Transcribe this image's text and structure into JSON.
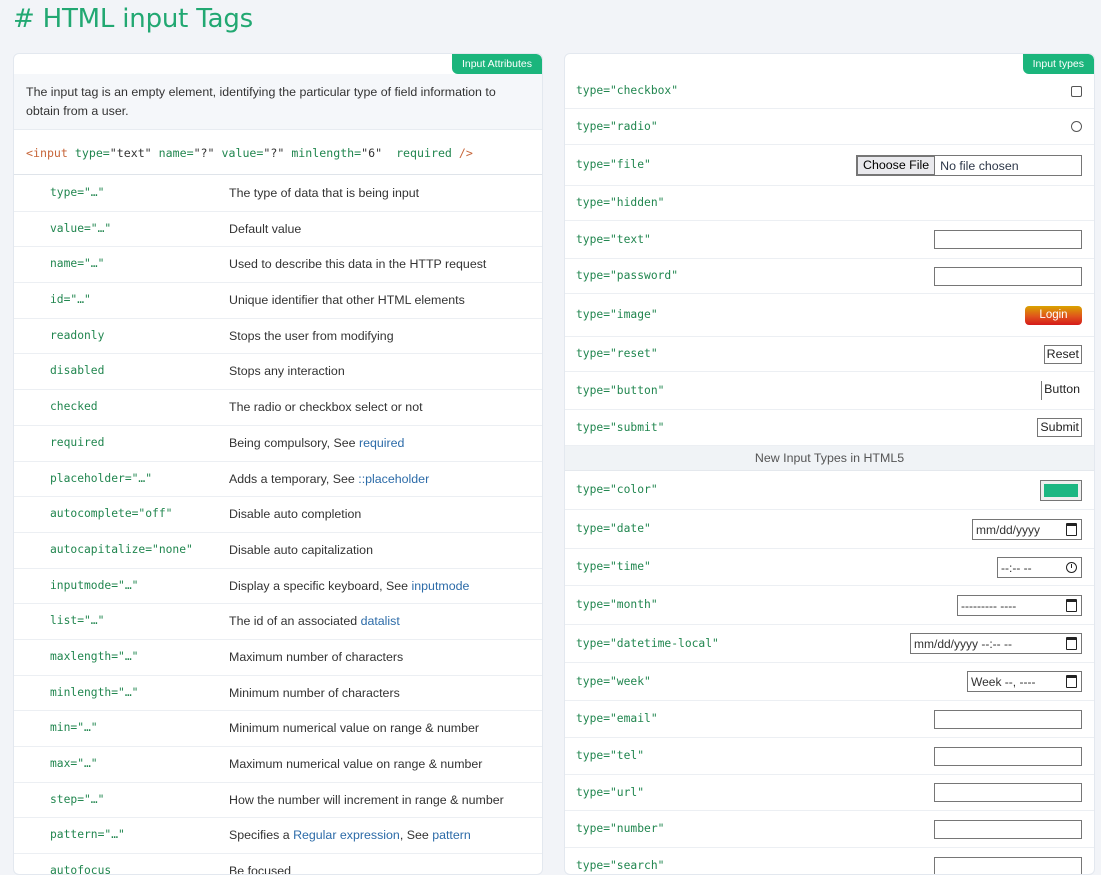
{
  "page": {
    "title": "# HTML input Tags"
  },
  "left": {
    "tag": "Input Attributes",
    "description": "The input tag is an empty element, identifying the particular type of field information to obtain from a user.",
    "example": {
      "open": "<input",
      "type_attr": "type=",
      "type_val": "\"text\"",
      "name_attr": "name=",
      "name_val": "\"?\"",
      "value_attr": "value=",
      "value_val": "\"?\"",
      "minlength_attr": "minlength=",
      "minlength_val": "\"6\"",
      "required": "required",
      "close": "/>"
    },
    "attributes": [
      {
        "name": "type=\"…\"",
        "desc": "The type of data that is being input",
        "link": ""
      },
      {
        "name": "value=\"…\"",
        "desc": "Default value",
        "link": ""
      },
      {
        "name": "name=\"…\"",
        "desc": "Used to describe this data in the HTTP request",
        "link": ""
      },
      {
        "name": "id=\"…\"",
        "desc": "Unique identifier that other HTML elements",
        "link": ""
      },
      {
        "name": "readonly",
        "desc": "Stops the user from modifying",
        "link": ""
      },
      {
        "name": "disabled",
        "desc": "Stops any interaction",
        "link": ""
      },
      {
        "name": "checked",
        "desc": "The radio or checkbox select or not",
        "link": ""
      },
      {
        "name": "required",
        "desc": "Being compulsory, See ",
        "link": "required"
      },
      {
        "name": "placeholder=\"…\"",
        "desc": "Adds a temporary, See ",
        "link": "::placeholder"
      },
      {
        "name": "autocomplete=\"off\"",
        "desc": "Disable auto completion",
        "link": ""
      },
      {
        "name": "autocapitalize=\"none\"",
        "desc": "Disable auto capitalization",
        "link": ""
      },
      {
        "name": "inputmode=\"…\"",
        "desc": "Display a specific keyboard, See ",
        "link": "inputmode"
      },
      {
        "name": "list=\"…\"",
        "desc": "The id of an associated ",
        "link": "datalist"
      },
      {
        "name": "maxlength=\"…\"",
        "desc": "Maximum number of characters",
        "link": ""
      },
      {
        "name": "minlength=\"…\"",
        "desc": "Minimum number of characters",
        "link": ""
      },
      {
        "name": "min=\"…\"",
        "desc": "Minimum numerical value on range & number",
        "link": ""
      },
      {
        "name": "max=\"…\"",
        "desc": "Maximum numerical value on range & number",
        "link": ""
      },
      {
        "name": "step=\"…\"",
        "desc": "How the number will increment in range & number",
        "link": ""
      },
      {
        "name": "pattern=\"…\"",
        "desc": "Specifies a ",
        "link": "Regular expression",
        "desc2": ", See ",
        "link2": "pattern"
      },
      {
        "name": "autofocus",
        "desc": "Be focused",
        "link": ""
      }
    ]
  },
  "right": {
    "tag": "Input types",
    "types_basic": [
      {
        "name": "type=\"checkbox\"",
        "control": "checkbox"
      },
      {
        "name": "type=\"radio\"",
        "control": "radio"
      },
      {
        "name": "type=\"file\"",
        "control": "file",
        "button": "Choose File",
        "status": "No file chosen"
      },
      {
        "name": "type=\"hidden\"",
        "control": "none"
      },
      {
        "name": "type=\"text\"",
        "control": "textbox"
      },
      {
        "name": "type=\"password\"",
        "control": "textbox"
      },
      {
        "name": "type=\"image\"",
        "control": "image",
        "label": "Login"
      },
      {
        "name": "type=\"reset\"",
        "control": "button",
        "label": "Reset"
      },
      {
        "name": "type=\"button\"",
        "control": "button-left",
        "label": "Button"
      },
      {
        "name": "type=\"submit\"",
        "control": "button",
        "label": "Submit"
      }
    ],
    "section_html5": "New Input Types in HTML5",
    "types_html5": [
      {
        "name": "type=\"color\"",
        "control": "color",
        "color": "#1cb782"
      },
      {
        "name": "type=\"date\"",
        "control": "date",
        "value": "mm/dd/yyyy",
        "icon": "calendar-icon"
      },
      {
        "name": "type=\"time\"",
        "control": "time",
        "value": "--:-- --",
        "icon": "clock-icon"
      },
      {
        "name": "type=\"month\"",
        "control": "month",
        "value": "--------- ----",
        "icon": "calendar-icon"
      },
      {
        "name": "type=\"datetime-local\"",
        "control": "datetime",
        "value": "mm/dd/yyyy --:-- --",
        "icon": "calendar-icon"
      },
      {
        "name": "type=\"week\"",
        "control": "week",
        "value": "Week --, ----",
        "icon": "calendar-icon"
      },
      {
        "name": "type=\"email\"",
        "control": "textbox"
      },
      {
        "name": "type=\"tel\"",
        "control": "textbox"
      },
      {
        "name": "type=\"url\"",
        "control": "textbox"
      },
      {
        "name": "type=\"number\"",
        "control": "textbox"
      },
      {
        "name": "type=\"search\"",
        "control": "textbox"
      }
    ]
  }
}
